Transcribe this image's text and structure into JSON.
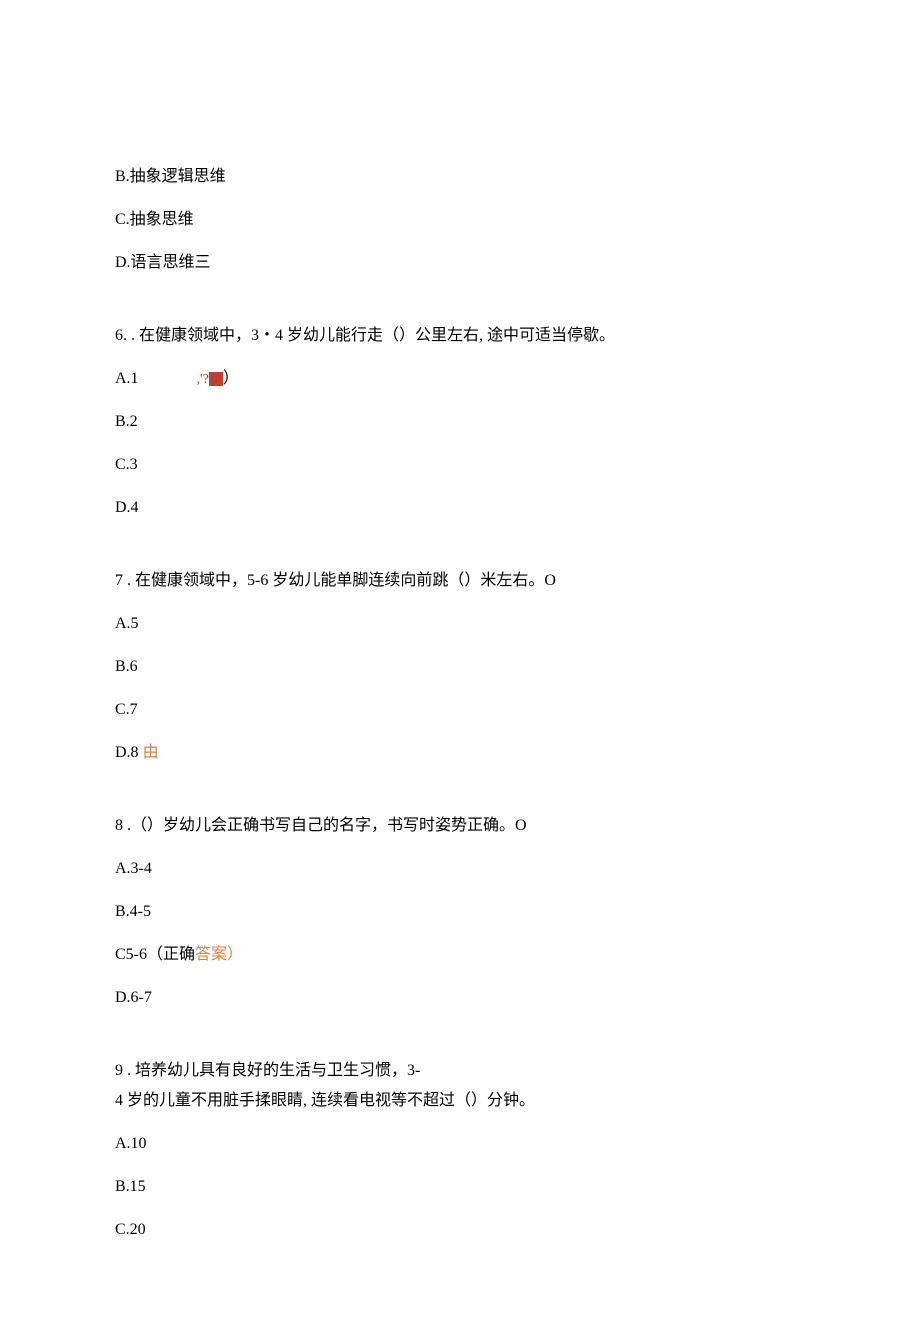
{
  "q5": {
    "optB": "B.抽象逻辑思维",
    "optC": "C.抽象思维",
    "optD": "D.语言思维三"
  },
  "q6": {
    "stem": "6. . 在健康领域中，3・4 岁幼儿能行走（）公里左右, 途中可适当停歇。",
    "optA_prefix": "A.1",
    "optA_mark": ",'?",
    "optA_paren": "）",
    "optB": "B.2",
    "optC": "C.3",
    "optD": "D.4"
  },
  "q7": {
    "stem": "7  . 在健康领域中，5-6 岁幼儿能单脚连续向前跳（）米左右。O",
    "optA": "A.5",
    "optB": "B.6",
    "optC": "C.7",
    "optD_prefix": "D.8 ",
    "optD_mark": "由"
  },
  "q8": {
    "stem": "8  .（）岁幼儿会正确书写自己的名字，书写时姿势正确。O",
    "optA": "A.3-4",
    "optB": "B.4-5",
    "optC_prefix": "C5-6（正确",
    "optC_ans": "答案）",
    "optD": "D.6-7"
  },
  "q9": {
    "stem1": "9  . 培养幼儿具有良好的生活与卫生习惯，3-",
    "stem2": "4 岁的儿童不用脏手揉眼睛, 连续看电视等不超过（）分钟。",
    "optA": "A.10",
    "optB": "B.15",
    "optC": "C.20"
  }
}
